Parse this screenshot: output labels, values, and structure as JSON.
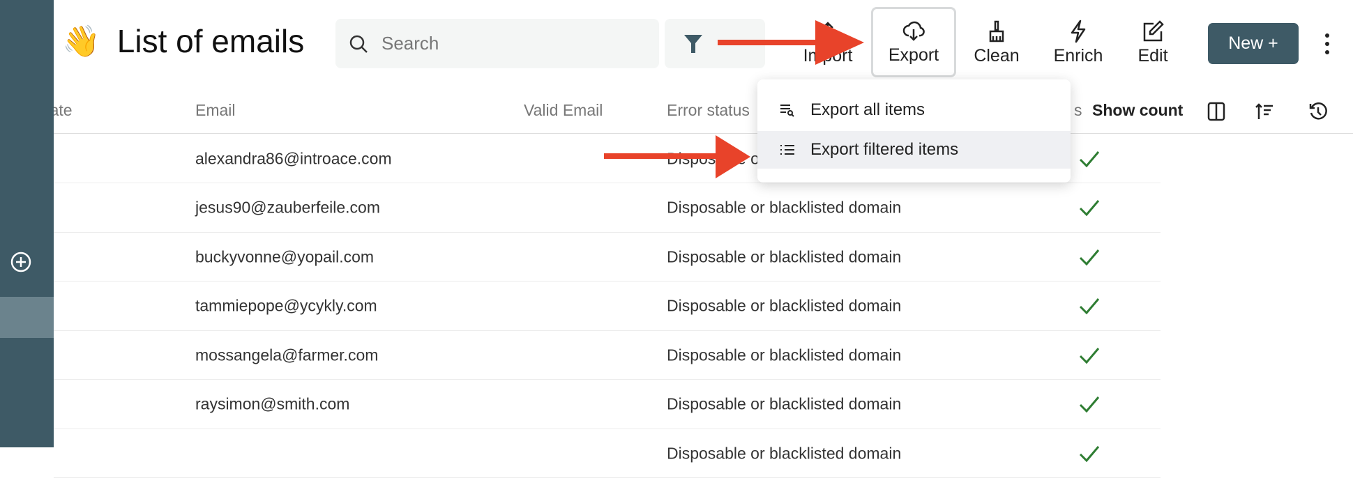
{
  "header": {
    "emoji": "👋",
    "title": "List of emails"
  },
  "search": {
    "placeholder": "Search",
    "value": ""
  },
  "toolbar": {
    "import": "Import",
    "export": "Export",
    "clean": "Clean",
    "enrich": "Enrich",
    "edit": "Edit",
    "new": "New +"
  },
  "table": {
    "columns": {
      "date": "Date",
      "email": "Email",
      "valid": "Valid Email",
      "error": "Error status",
      "matches": "s"
    },
    "show_count": "Show count",
    "rows": [
      {
        "email": "alexandra86@introace.com",
        "error": "Disposable or blacklisted domain",
        "valid": true
      },
      {
        "email": "jesus90@zauberfeile.com",
        "error": "Disposable or blacklisted domain",
        "valid": true
      },
      {
        "email": "buckyvonne@yopail.com",
        "error": "Disposable or blacklisted domain",
        "valid": true
      },
      {
        "email": "tammiepope@ycykly.com",
        "error": "Disposable or blacklisted domain",
        "valid": true
      },
      {
        "email": "mossangela@farmer.com",
        "error": "Disposable or blacklisted domain",
        "valid": true
      },
      {
        "email": "raysimon@smith.com",
        "error": "Disposable or blacklisted domain",
        "valid": true
      },
      {
        "email": "",
        "error": "Disposable or blacklisted domain",
        "valid": true
      }
    ]
  },
  "export_menu": {
    "items": [
      {
        "label": "Export all items",
        "icon": "list-search-icon"
      },
      {
        "label": "Export filtered items",
        "icon": "list-icon",
        "highlighted": true
      }
    ]
  },
  "colors": {
    "sidebar": "#3e5a66",
    "accent": "#3e5a66",
    "check": "#2e7d32",
    "annotation_arrow": "#e8432a"
  }
}
